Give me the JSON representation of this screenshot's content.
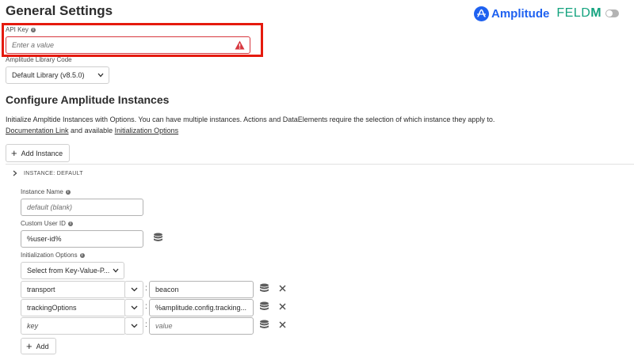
{
  "header": {
    "title": "General Settings",
    "brand_name": "Amplitude",
    "partner_prefix": "FELD",
    "partner_suffix": "M"
  },
  "api_key": {
    "label": "API Key",
    "placeholder": "Enter a value",
    "state": "invalid"
  },
  "library": {
    "label": "Amplitude Library Code",
    "selected": "Default Library (v8.5.0)"
  },
  "instances": {
    "title": "Configure Amplitude Instances",
    "description": "Initialize Ampltide Instances with Options. You can have multiple instances. Actions and DataElements require the selection of which instance they apply to.",
    "doc_link": "Documentation Link",
    "and_available": " and available ",
    "options_link": "Initialization Options",
    "add_instance_label": "Add Instance",
    "section_header": "INSTANCE: DEFAULT"
  },
  "instance_form": {
    "name_label": "Instance Name",
    "name_placeholder": "default (blank)",
    "user_id_label": "Custom User ID",
    "user_id_value": "%user-id%",
    "init_options_label": "Initialization Options",
    "kv_picker": "Select from Key-Value-P...",
    "rows": [
      {
        "key": "transport",
        "value": "beacon",
        "key_placeholder": false,
        "value_placeholder": false
      },
      {
        "key": "trackingOptions",
        "value": "%amplitude.config.tracking...",
        "key_placeholder": false,
        "value_placeholder": false
      },
      {
        "key": "key",
        "value": "value",
        "key_placeholder": true,
        "value_placeholder": true
      }
    ],
    "add_label": "Add"
  },
  "colors": {
    "highlight": "#e51a0e",
    "amplitude_blue": "#1e61f0",
    "feldm_green": "#14a37f",
    "warning_red": "#d7373f"
  }
}
